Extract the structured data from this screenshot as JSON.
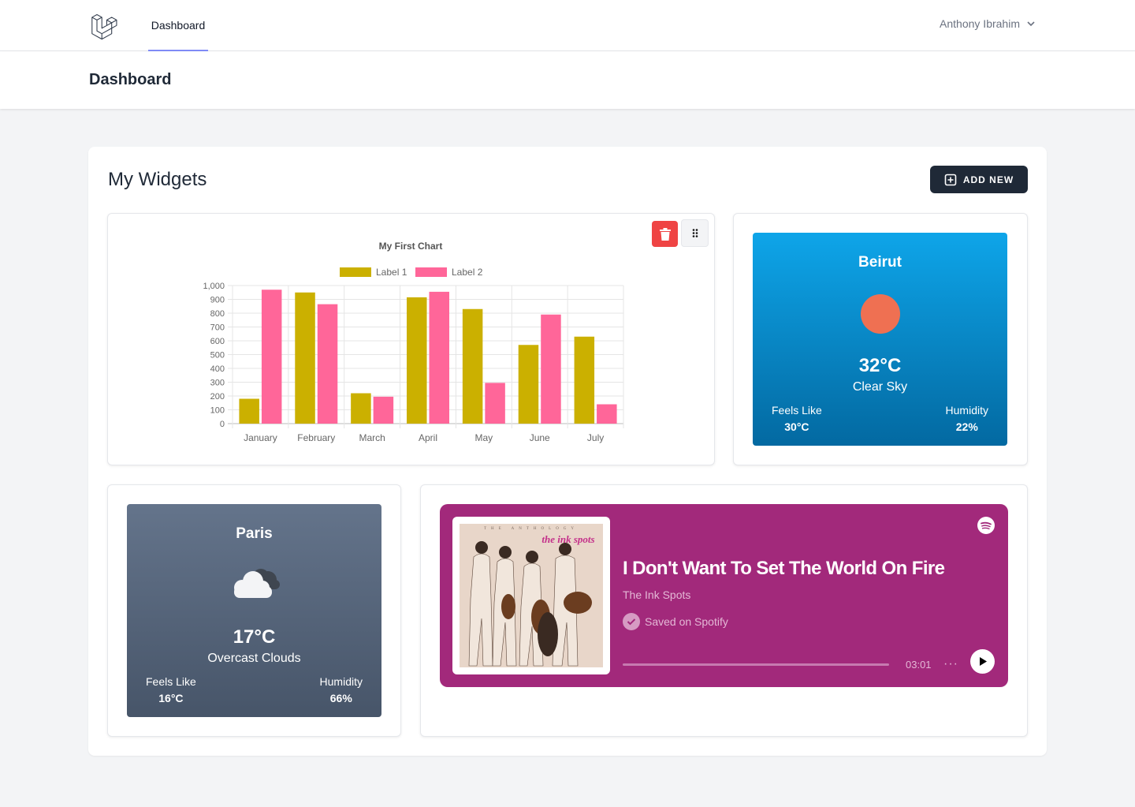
{
  "nav": {
    "links": [
      {
        "label": "Dashboard"
      }
    ],
    "user": {
      "name": "Anthony Ibrahim"
    }
  },
  "header": {
    "title": "Dashboard"
  },
  "widgets_section": {
    "title": "My Widgets",
    "add_button_label": "ADD NEW"
  },
  "chart_widget": {
    "chart_data": {
      "type": "bar",
      "title": "My First Chart",
      "categories": [
        "January",
        "February",
        "March",
        "April",
        "May",
        "June",
        "July"
      ],
      "series": [
        {
          "name": "Label 1",
          "color": "#cbb000",
          "values": [
            180,
            950,
            220,
            915,
            830,
            570,
            630
          ]
        },
        {
          "name": "Label 2",
          "color": "#ff6699",
          "values": [
            970,
            865,
            195,
            955,
            295,
            790,
            140
          ]
        }
      ],
      "ylim": [
        0,
        1000
      ],
      "yticks": [
        "0",
        "100",
        "200",
        "300",
        "400",
        "500",
        "600",
        "700",
        "800",
        "900",
        "1,000"
      ],
      "grid": true,
      "legend": "top"
    }
  },
  "weather_beirut": {
    "city": "Beirut",
    "icon": "sun-icon",
    "temperature": "32°C",
    "description": "Clear Sky",
    "feels_like_label": "Feels Like",
    "feels_like_value": "30°C",
    "humidity_label": "Humidity",
    "humidity_value": "22%",
    "colors": {
      "gradient_top": "#0ea5e9",
      "gradient_bottom": "#0369a1",
      "sun": "#ef7052"
    }
  },
  "weather_paris": {
    "city": "Paris",
    "icon": "cloud-icon",
    "temperature": "17°C",
    "description": "Overcast Clouds",
    "feels_like_label": "Feels Like",
    "feels_like_value": "16°C",
    "humidity_label": "Humidity",
    "humidity_value": "66%",
    "colors": {
      "gradient_top": "#64748b",
      "gradient_bottom": "#475569"
    }
  },
  "spotify_widget": {
    "album_text_top": "THE ANTHOLOGY",
    "album_text_brand": "the ink spots",
    "song_title": "I Don't Want To Set The World On Fire",
    "artist": "The Ink Spots",
    "saved_label": "Saved on Spotify",
    "progress": 0,
    "duration": "03:01",
    "more_label": "···",
    "colors": {
      "background": "#a2297b"
    }
  }
}
